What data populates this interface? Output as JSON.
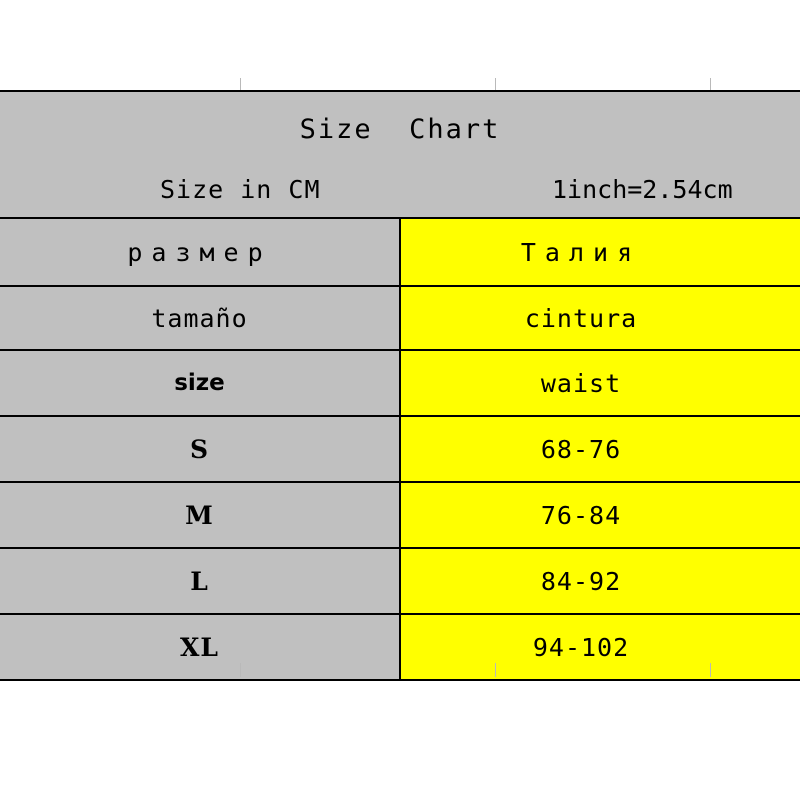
{
  "chart_data": {
    "type": "table",
    "title": "Size Chart",
    "subtitle_left": "Size in CM",
    "subtitle_right": "1inch=2.54cm",
    "columns": [
      "size",
      "waist"
    ],
    "column_labels": {
      "ru": [
        "размер",
        "Талия"
      ],
      "es": [
        "tamaño",
        "cintura"
      ],
      "en": [
        "size",
        "waist"
      ]
    },
    "categories": [
      "S",
      "M",
      "L",
      "XL"
    ],
    "values": [
      "68-76",
      "76-84",
      "84-92",
      "94-102"
    ],
    "units": "cm",
    "colors": {
      "header_bg": "#C0C0C0",
      "value_bg": "#FFFF00",
      "text": "#000000"
    }
  },
  "header": {
    "title": "Size  Chart",
    "units_note": "Size in CM",
    "conversion_note": "1inch=2.54cm"
  },
  "table": {
    "localized": {
      "russian": {
        "size": "размер",
        "waist": "Талия"
      },
      "spanish": {
        "size": "tamaño",
        "waist": "cintura"
      }
    },
    "column_headers": {
      "size": "size",
      "waist": "waist"
    },
    "rows": [
      {
        "size": "S",
        "waist": "68-76"
      },
      {
        "size": "M",
        "waist": "76-84"
      },
      {
        "size": "L",
        "waist": "84-92"
      },
      {
        "size": "XL",
        "waist": "94-102"
      }
    ]
  }
}
